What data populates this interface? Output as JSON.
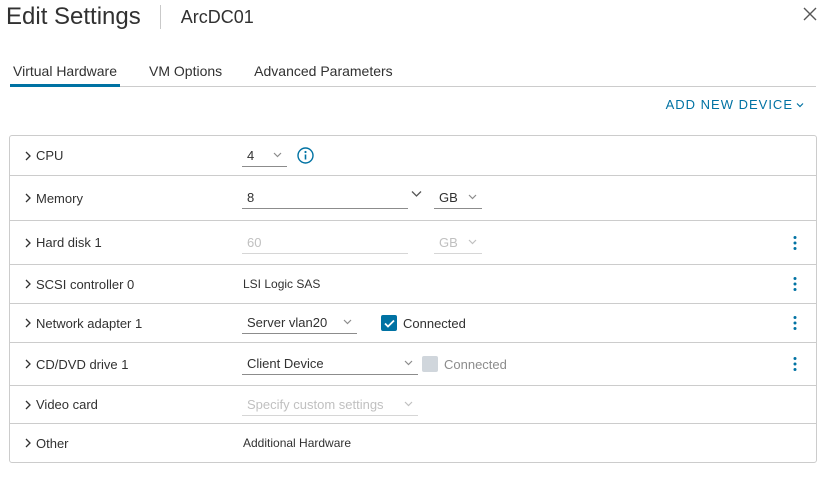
{
  "header": {
    "title": "Edit Settings",
    "vm_name": "ArcDC01"
  },
  "tabs": [
    {
      "label": "Virtual Hardware",
      "active": true
    },
    {
      "label": "VM Options",
      "active": false
    },
    {
      "label": "Advanced Parameters",
      "active": false
    }
  ],
  "add_device": {
    "label": "ADD NEW DEVICE"
  },
  "rows": {
    "cpu": {
      "label": "CPU",
      "value": "4"
    },
    "memory": {
      "label": "Memory",
      "value": "8",
      "unit": "GB"
    },
    "hard_disk": {
      "label": "Hard disk 1",
      "value": "60",
      "unit": "GB"
    },
    "scsi": {
      "label": "SCSI controller 0",
      "value": "LSI Logic SAS"
    },
    "network": {
      "label": "Network adapter 1",
      "value": "Server vlan20",
      "connected_label": "Connected",
      "connected": true
    },
    "cdrom": {
      "label": "CD/DVD drive 1",
      "value": "Client Device",
      "connected_label": "Connected",
      "connected": false
    },
    "video": {
      "label": "Video card",
      "value": "Specify custom settings"
    },
    "other": {
      "label": "Other",
      "value": "Additional Hardware"
    }
  },
  "colors": {
    "accent": "#0072a3",
    "border": "#cccccc",
    "text": "#313131",
    "disabled_text": "#c0c0c0"
  },
  "icons": {
    "close": "close-icon",
    "info": "info-icon",
    "expander": "chevron-right-icon",
    "caret": "chevron-down-icon",
    "more": "vertical-ellipsis-icon",
    "check": "checkmark-icon"
  }
}
